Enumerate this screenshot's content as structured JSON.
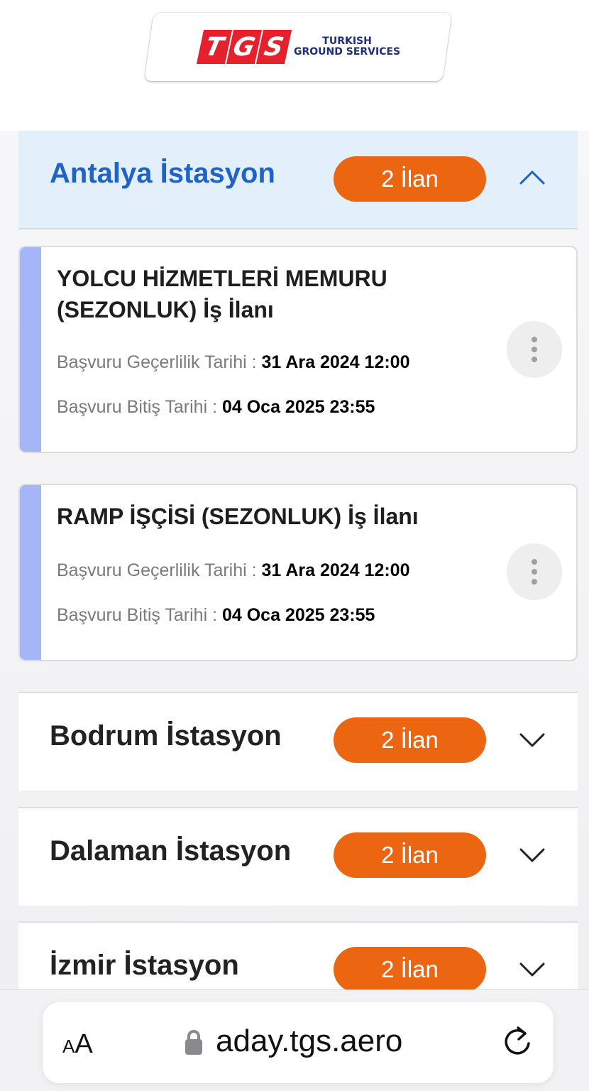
{
  "header": {
    "logo_letters": [
      "T",
      "G",
      "S"
    ],
    "logo_line1": "TURKISH",
    "logo_line2": "GROUND SERVICES"
  },
  "stations": [
    {
      "name": "Antalya İstasyon",
      "badge": "2 İlan",
      "expanded": true,
      "jobs": [
        {
          "title": "YOLCU HİZMETLERİ MEMURU (SEZONLUK) İş İlanı",
          "valid_label": "Başvuru Geçerlilik Tarihi : ",
          "valid_value": "31 Ara 2024 12:00",
          "end_label": "Başvuru Bitiş Tarihi : ",
          "end_value": "04 Oca 2025 23:55"
        },
        {
          "title": "RAMP İŞÇİSİ (SEZONLUK) İş İlanı",
          "valid_label": "Başvuru Geçerlilik Tarihi : ",
          "valid_value": "31 Ara 2024 12:00",
          "end_label": "Başvuru Bitiş Tarihi : ",
          "end_value": "04 Oca 2025 23:55"
        }
      ]
    },
    {
      "name": "Bodrum İstasyon",
      "badge": "2 İlan",
      "expanded": false
    },
    {
      "name": "Dalaman İstasyon",
      "badge": "2 İlan",
      "expanded": false
    },
    {
      "name": "İzmir İstasyon",
      "badge": "2 İlan",
      "expanded": false
    }
  ],
  "browser": {
    "text_size_small": "A",
    "text_size_large": "A",
    "url": "aday.tgs.aero"
  },
  "colors": {
    "accent_blue": "#1f62c8",
    "badge_orange": "#ec6511",
    "stripe_blue": "#a4b6f7",
    "logo_red": "#e4212d",
    "logo_navy": "#1c2f79"
  }
}
